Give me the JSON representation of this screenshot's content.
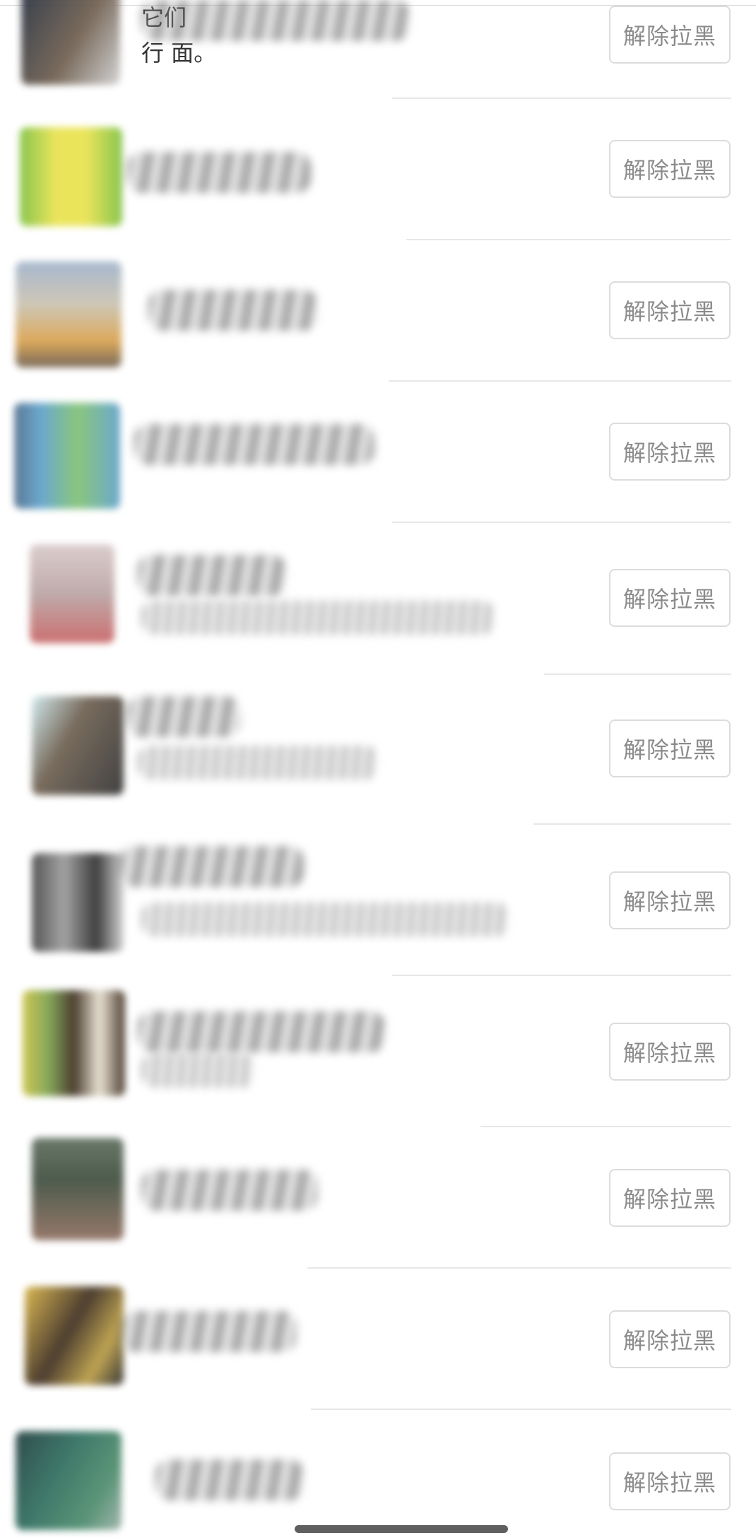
{
  "unblock_label": "解除拉黑",
  "rows": [
    {
      "avatar_colors": [
        "#1f2a3a",
        "#6b5a4a",
        "#cfcfcf"
      ]
    },
    {
      "avatar_colors": [
        "#e8e24a",
        "#7bbf3a",
        "#c9c9c9"
      ]
    },
    {
      "avatar_colors": [
        "#d8a04a",
        "#9db0c8",
        "#6a5a4a"
      ]
    },
    {
      "avatar_colors": [
        "#5b9fc9",
        "#7ec070",
        "#4a6a8a"
      ]
    },
    {
      "avatar_colors": [
        "#b9a2a2",
        "#c66060",
        "#d8c8c8"
      ]
    },
    {
      "avatar_colors": [
        "#2e2e2e",
        "#6a5c4c",
        "#cde8ec"
      ]
    },
    {
      "avatar_colors": [
        "#2a2a2a",
        "#9a9a9a",
        "#444444"
      ]
    },
    {
      "avatar_colors": [
        "#c9c040",
        "#3a2a1a",
        "#7aa04a"
      ]
    },
    {
      "avatar_colors": [
        "#5a6a5a",
        "#8a6a5a",
        "#3a4a3a"
      ]
    },
    {
      "avatar_colors": [
        "#d8b040",
        "#3a2a1a",
        "#b89a40"
      ]
    },
    {
      "avatar_colors": [
        "#2a6a5a",
        "#4a8a6a",
        "#1a3a3a"
      ]
    }
  ],
  "partial_text": {
    "line1": "它们",
    "line2": "行    面。"
  }
}
